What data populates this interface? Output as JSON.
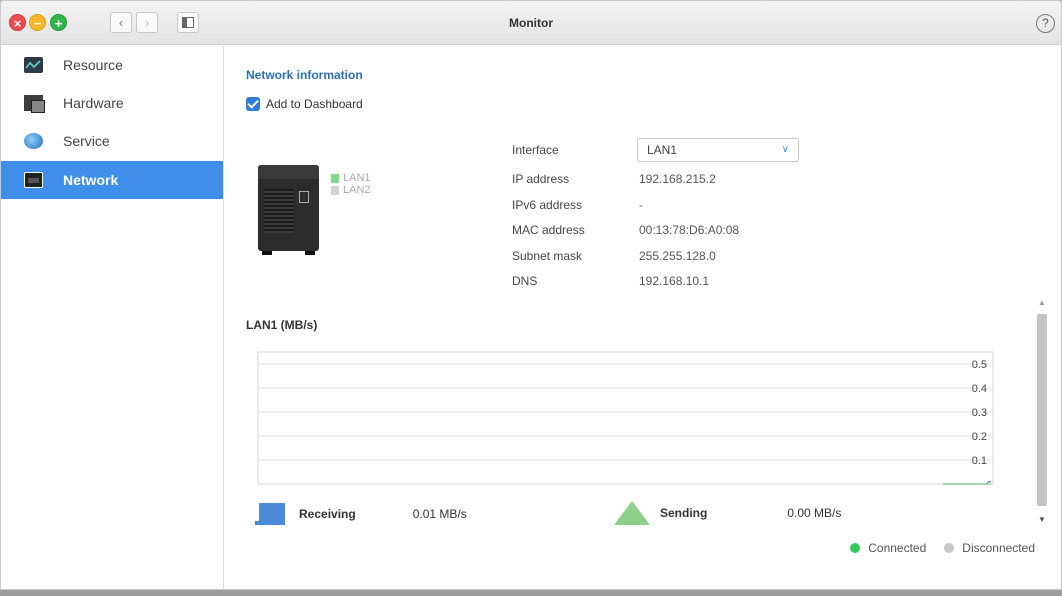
{
  "window": {
    "title": "Monitor"
  },
  "sidebar": {
    "items": [
      {
        "label": "Resource",
        "icon": "resource-chart-icon",
        "active": false
      },
      {
        "label": "Hardware",
        "icon": "hardware-icon",
        "active": false
      },
      {
        "label": "Service",
        "icon": "globe-icon",
        "active": false
      },
      {
        "label": "Network",
        "icon": "network-icon",
        "active": true
      }
    ]
  },
  "main": {
    "section_title": "Network information",
    "add_to_dashboard": {
      "label": "Add to Dashboard",
      "checked": true
    },
    "device_ports": [
      {
        "label": "LAN1",
        "color": "#7fd98a"
      },
      {
        "label": "LAN2",
        "color": "#cccccc"
      }
    ],
    "interface": {
      "label": "Interface",
      "value": "LAN1"
    },
    "info": [
      {
        "label": "IP address",
        "value": "192.168.215.2"
      },
      {
        "label": "IPv6 address",
        "value": "-"
      },
      {
        "label": "MAC address",
        "value": "00:13:78:D6:A0:08"
      },
      {
        "label": "Subnet mask",
        "value": "255.255.128.0"
      },
      {
        "label": "DNS",
        "value": "192.168.10.1"
      }
    ],
    "chart_title": "LAN1 (MB/s)",
    "receiving": {
      "label": "Receiving",
      "value": "0.01 MB/s",
      "color": "#4a8ad8"
    },
    "sending": {
      "label": "Sending",
      "value": "0.00 MB/s",
      "color": "#8dd08a"
    },
    "status": {
      "connected": {
        "label": "Connected",
        "color": "#35c759"
      },
      "disconnected": {
        "label": "Disconnected",
        "color": "#c8c8c8"
      }
    }
  },
  "chart_data": {
    "type": "line",
    "title": "LAN1 (MB/s)",
    "ylim": [
      0,
      0.55
    ],
    "yticks": [
      "0.1",
      "0.2",
      "0.3",
      "0.4",
      "0.5"
    ],
    "grid": true,
    "series": [
      {
        "name": "Receiving",
        "color": "#4a8ad8",
        "values": [
          0,
          0,
          0,
          0,
          0,
          0,
          0,
          0,
          0,
          0,
          0,
          0,
          0,
          0,
          0,
          0,
          0,
          0,
          0,
          0,
          0.01,
          0.01
        ]
      },
      {
        "name": "Sending",
        "color": "#8dd08a",
        "values": [
          0,
          0,
          0,
          0,
          0,
          0,
          0,
          0,
          0,
          0,
          0,
          0,
          0,
          0,
          0,
          0,
          0,
          0,
          0,
          0,
          0,
          0
        ]
      }
    ]
  }
}
